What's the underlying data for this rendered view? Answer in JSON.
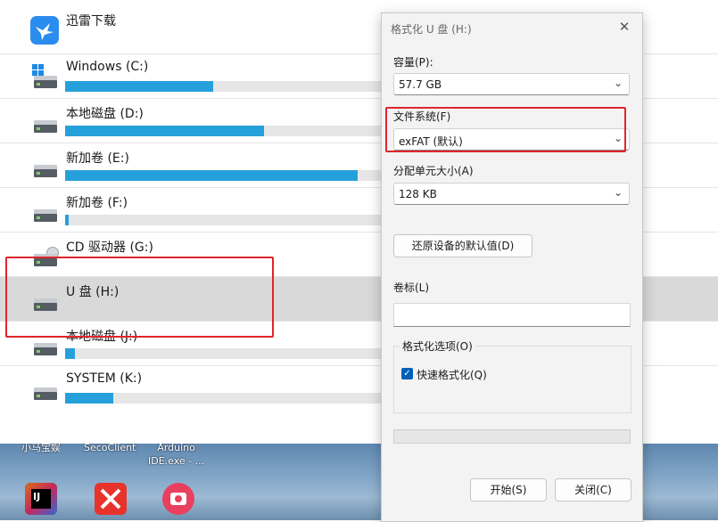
{
  "explorer": {
    "top_item": {
      "label": "迅雷下载",
      "icon": "thunder-bird-icon"
    },
    "drives": [
      {
        "label": "Windows (C:)",
        "icon": "windows-drive-icon",
        "used_fraction": 0.46,
        "selected": false
      },
      {
        "label": "本地磁盘 (D:)",
        "icon": "drive-icon",
        "used_fraction": 0.62,
        "selected": false
      },
      {
        "label": "新加卷 (E:)",
        "icon": "drive-icon",
        "used_fraction": 0.91,
        "selected": false
      },
      {
        "label": "新加卷 (F:)",
        "icon": "drive-icon",
        "used_fraction": 0.01,
        "selected": false
      },
      {
        "label": "CD 驱动器 (G:)",
        "icon": "cd-drive-icon",
        "used_fraction": null,
        "selected": false
      },
      {
        "label": "U 盘 (H:)",
        "icon": "usb-drive-icon",
        "used_fraction": null,
        "selected": true
      },
      {
        "label": "本地磁盘 (J:)",
        "icon": "drive-icon",
        "used_fraction": 0.03,
        "selected": false
      },
      {
        "label": "SYSTEM (K:)",
        "icon": "drive-icon",
        "used_fraction": 0.15,
        "selected": false
      }
    ]
  },
  "desktop": {
    "labels": [
      "小马宝娱",
      "SecoClient",
      "Arduino\nIDE.exe - ..."
    ],
    "icons": [
      "intellij-idea-icon",
      "xmind-icon",
      "camera-app-icon"
    ],
    "icon_text": {
      "idea": "IJ"
    }
  },
  "dialog": {
    "title": "格式化 U 盘 (H:)",
    "close_glyph": "✕",
    "capacity_label": "容量(P):",
    "capacity_value": "57.7 GB",
    "filesystem_label": "文件系统(F)",
    "filesystem_value": "exFAT (默认)",
    "allocation_label": "分配单元大小(A)",
    "allocation_value": "128 KB",
    "restore_defaults_label": "还原设备的默认值(D)",
    "volume_label_label": "卷标(L)",
    "volume_label_value": "",
    "format_options_label": "格式化选项(O)",
    "quick_format_label": "快速格式化(Q)",
    "quick_format_checked": true,
    "progress": 0,
    "start_label": "开始(S)",
    "close_label": "关闭(C)"
  },
  "colors": {
    "accent": "#26a0da",
    "highlight": "#e0252b",
    "checkbox": "#005fb8"
  }
}
